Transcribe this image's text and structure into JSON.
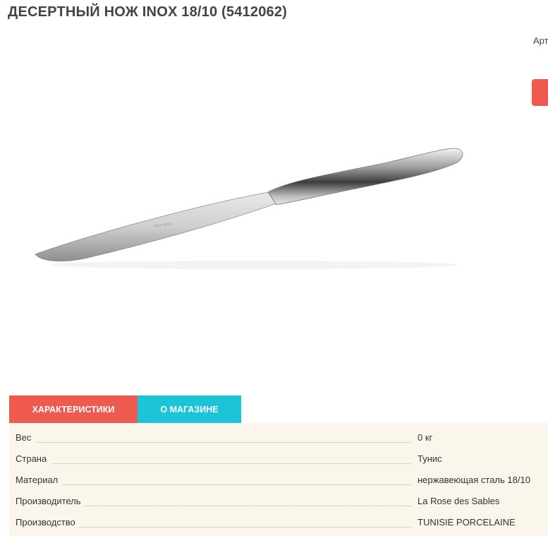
{
  "product": {
    "title": "ДЕСЕРТНЫЙ НОЖ INOX 18/10 (5412062)",
    "article_label": "Арт"
  },
  "tabs": [
    {
      "label": "ХАРАКТЕРИСТИКИ",
      "active": true
    },
    {
      "label": "О МАГАЗИНЕ",
      "active": false
    }
  ],
  "specs": [
    {
      "name": "Вес",
      "value": "0 кг"
    },
    {
      "name": "Страна",
      "value": "Тунис"
    },
    {
      "name": "Материал",
      "value": "нержавеющая сталь 18/10"
    },
    {
      "name": "Производитель",
      "value": "La Rose des Sables"
    },
    {
      "name": "Производство",
      "value": "TUNISIE PORCELAINE"
    }
  ],
  "colors": {
    "accent_red": "#ee5b4e",
    "accent_cyan": "#1cc4d8",
    "specs_background": "#faf6ec"
  },
  "icons": {
    "product_image": "dessert-knife-photo"
  }
}
